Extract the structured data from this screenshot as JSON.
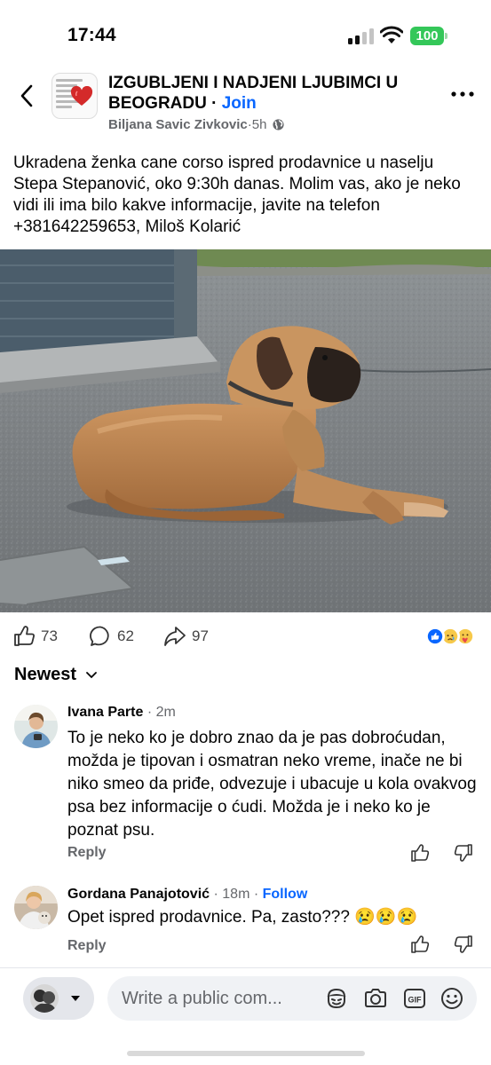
{
  "status_bar": {
    "time": "17:44",
    "battery": "100",
    "battery_color": "#34c759"
  },
  "header": {
    "group_name": "IZGUBLJENI I NADJENI LJUBIMCI U BEOGRADU",
    "separator": " · ",
    "join_label": "Join",
    "author": "Biljana Savic Zivkovic",
    "time_sep": " · ",
    "time": "5h",
    "privacy_icon": "globe-icon",
    "accent": "#0866ff"
  },
  "post": {
    "text": "Ukradena ženka cane corso ispred prodavnice u naselju Stepa Stepanović, oko 9:30h danas. Molim vas, ako je neko vidi ili ima bilo kakve informacije, javite na telefon +381642259653, Miloš Kolarić"
  },
  "stats": {
    "likes": "73",
    "comments": "62",
    "shares": "97",
    "reactions": [
      "like-icon",
      "sad-icon",
      "care-icon"
    ]
  },
  "sort": {
    "label": "Newest"
  },
  "comments": [
    {
      "name": "Ivana Parte",
      "sep": " · ",
      "time": "2m",
      "follow": "",
      "text": "To je neko ko je dobro znao da je pas dobroćudan, možda je tipovan i osmatran neko vreme, inače ne bi niko smeo da priđe, odvezuje i ubacuje u kola ovakvog psa bez informacije o ćudi.  Možda je i neko ko je poznat psu.",
      "reply": "Reply"
    },
    {
      "name": "Gordana Panajotović",
      "sep": " · ",
      "time": "18m",
      "follow_sep": " · ",
      "follow": "Follow",
      "text": "Opet ispred prodavnice. Pa, zasto??? 😢😢😢",
      "reply": "Reply"
    }
  ],
  "composer": {
    "placeholder": "Write a public com...",
    "icons": [
      "avatar-sticker-icon",
      "camera-icon",
      "gif-icon",
      "emoji-icon"
    ]
  }
}
